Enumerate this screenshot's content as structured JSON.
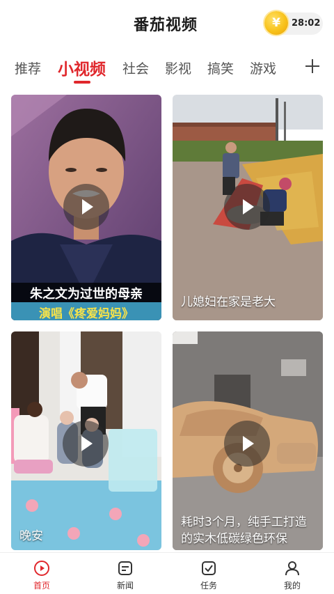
{
  "header": {
    "title": "番茄视频",
    "coin_symbol": "¥",
    "timer": "28:02"
  },
  "tabs": [
    "推荐",
    "小视频",
    "社会",
    "影视",
    "搞笑",
    "游戏"
  ],
  "active_tab": "小视频",
  "feed": [
    {
      "caption_line1": "朱之文为过世的母亲",
      "caption_line2": "演唱《疼爱妈妈》"
    },
    {
      "caption": "儿媳妇在家是老大"
    },
    {
      "caption": "晚安"
    },
    {
      "caption": "耗时3个月，纯手工打造的实木低碳绿色环保"
    }
  ],
  "bottom_nav": [
    {
      "label": "首页",
      "icon": "play-circle-icon",
      "active": true
    },
    {
      "label": "新闻",
      "icon": "news-icon",
      "active": false
    },
    {
      "label": "任务",
      "icon": "task-check-icon",
      "active": false
    },
    {
      "label": "我的",
      "icon": "profile-icon",
      "active": false
    }
  ],
  "colors": {
    "accent": "#e0272c",
    "coin": "#f8c21a"
  }
}
